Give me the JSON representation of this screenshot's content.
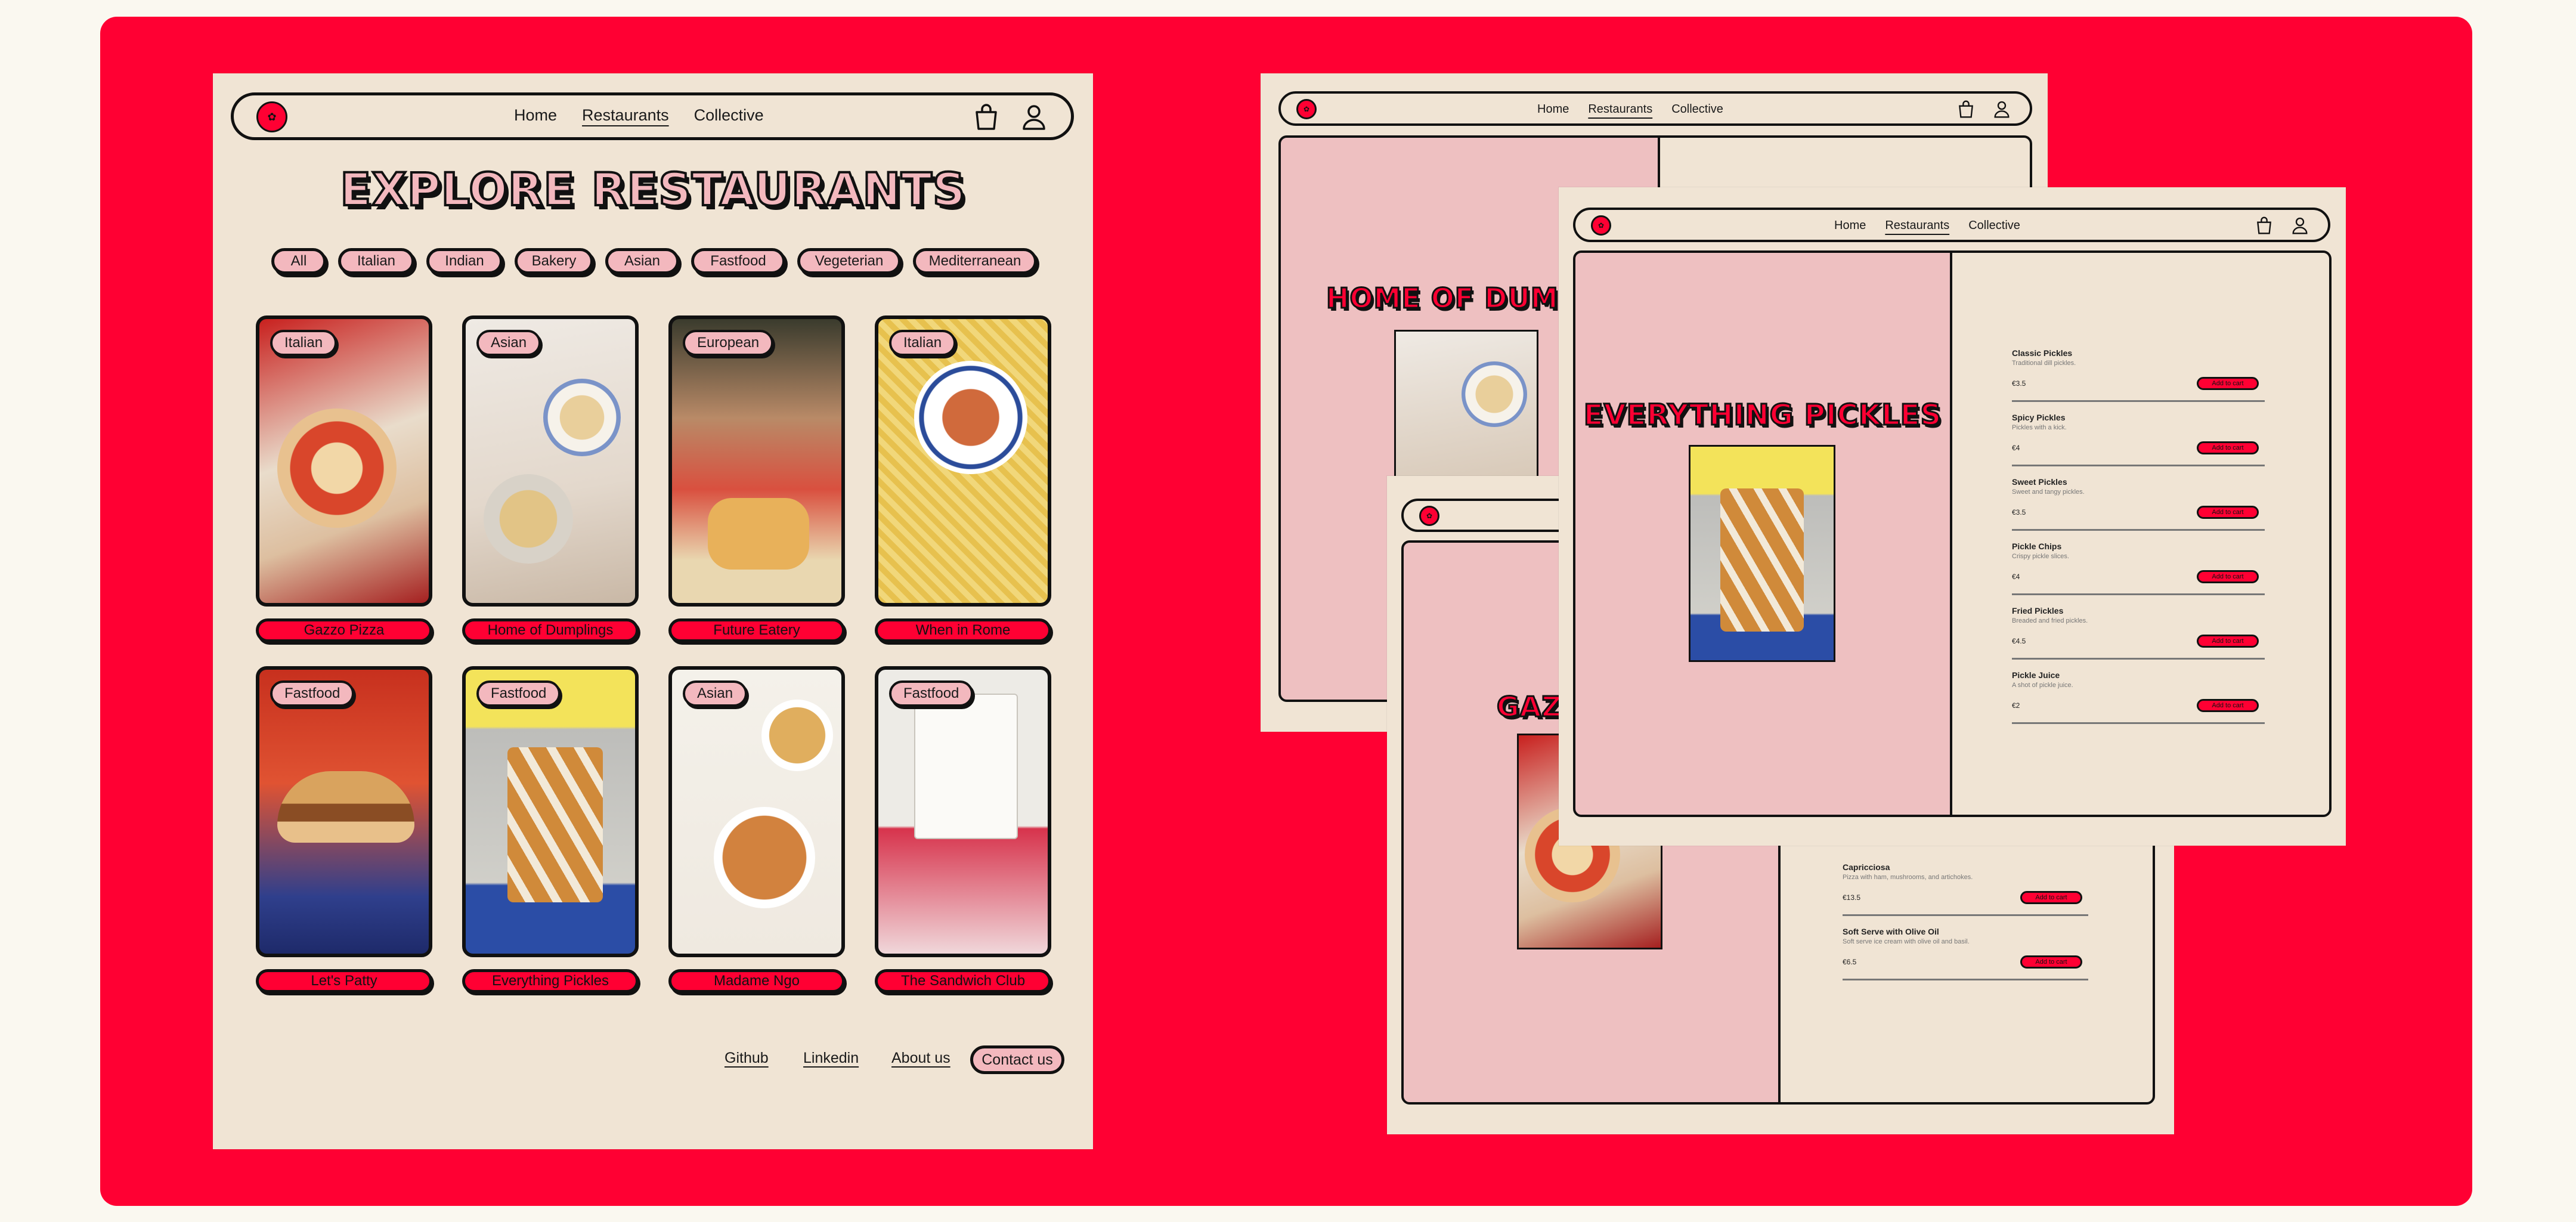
{
  "nav": {
    "links": [
      "Home",
      "Restaurants",
      "Collective"
    ],
    "active": "Restaurants",
    "cart_icon": "shopping-bag-icon",
    "user_icon": "user-icon"
  },
  "explore": {
    "title": "EXPLORE RESTAURANTS",
    "filters": [
      "All",
      "Italian",
      "Indian",
      "Bakery",
      "Asian",
      "Fastfood",
      "Vegeterian",
      "Mediterranean"
    ],
    "restaurants": [
      {
        "tag": "Italian",
        "name": "Gazzo Pizza"
      },
      {
        "tag": "Asian",
        "name": "Home of Dumplings"
      },
      {
        "tag": "European",
        "name": "Future Eatery"
      },
      {
        "tag": "Italian",
        "name": "When in Rome"
      },
      {
        "tag": "Fastfood",
        "name": "Let's Patty"
      },
      {
        "tag": "Fastfood",
        "name": "Everything Pickles"
      },
      {
        "tag": "Asian",
        "name": "Madame Ngo"
      },
      {
        "tag": "Fastfood",
        "name": "The Sandwich Club"
      }
    ],
    "footer": {
      "github": "Github",
      "linkedin": "Linkedin",
      "about": "About us",
      "contact": "Contact us"
    }
  },
  "dumplings_page": {
    "title": "HOME OF DUMPLI"
  },
  "gazzo_page": {
    "title": "GAZ",
    "items": [
      {
        "name": "Capricciosa",
        "desc": "Pizza with ham, mushrooms, and artichokes.",
        "price": "€13.5",
        "button": "Add to cart"
      },
      {
        "name": "Soft Serve with Olive Oil",
        "desc": "Soft serve ice cream with olive oil and basil.",
        "price": "€6.5",
        "button": "Add to cart"
      }
    ]
  },
  "pickles_page": {
    "title": "EVERYTHING PICKLES",
    "items": [
      {
        "name": "Classic Pickles",
        "desc": "Traditional dill pickles.",
        "price": "€3.5",
        "button": "Add to cart"
      },
      {
        "name": "Spicy Pickles",
        "desc": "Pickles with a kick.",
        "price": "€4",
        "button": "Add to cart"
      },
      {
        "name": "Sweet Pickles",
        "desc": "Sweet and tangy pickles.",
        "price": "€3.5",
        "button": "Add to cart"
      },
      {
        "name": "Pickle Chips",
        "desc": "Crispy pickle slices.",
        "price": "€4",
        "button": "Add to cart"
      },
      {
        "name": "Fried Pickles",
        "desc": "Breaded and fried pickles.",
        "price": "€4.5",
        "button": "Add to cart"
      },
      {
        "name": "Pickle Juice",
        "desc": "A shot of pickle juice.",
        "price": "€2",
        "button": "Add to cart"
      }
    ]
  },
  "colors": {
    "brand_red": "#FF0033",
    "cream": "#F0E4D4",
    "pink": "#F3B8BE",
    "ink": "#111111"
  }
}
